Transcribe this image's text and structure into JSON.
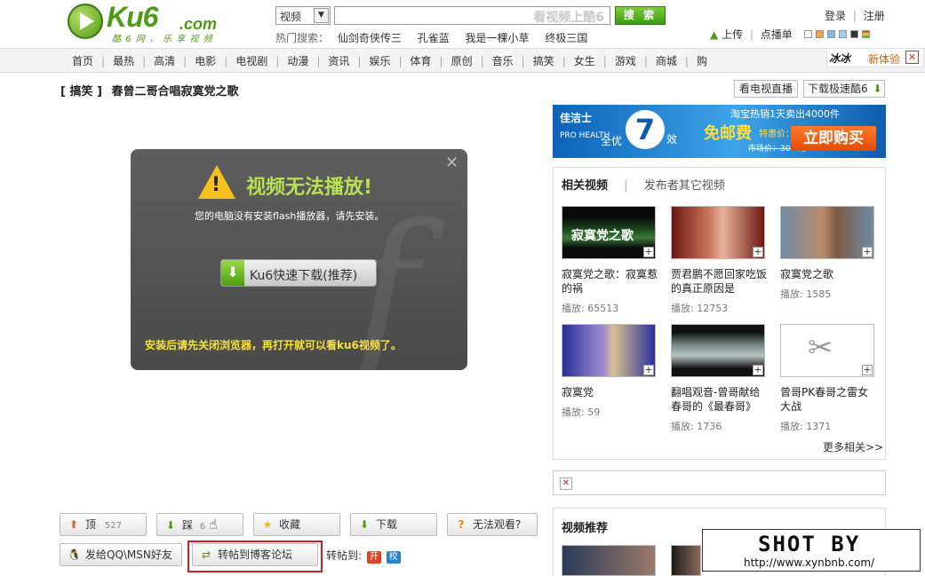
{
  "header": {
    "logo_text": "Ku6",
    "logo_domain": ".com",
    "logo_slogan": "酷 6 网 ， 乐 享 视 频",
    "search_type": "视频",
    "search_placeholder": "看视频上酷6",
    "search_button": "搜 索",
    "hot_label": "热门搜索：",
    "hot_terms": [
      "仙剑奇侠传三",
      "孔雀蓝",
      "我是一棵小草",
      "终极三国"
    ],
    "login": "登录",
    "register": "注册",
    "upload": "上传",
    "playlist": "点播单",
    "swatch_colors": [
      "#ffffff",
      "#f0a040",
      "#7fb8e8",
      "#9fd0f0",
      "#333333",
      "#5aa0d8"
    ],
    "new_experience": "新体验"
  },
  "nav": {
    "items": [
      "首页",
      "最热",
      "高清",
      "电影",
      "电视剧",
      "动漫",
      "资讯",
      "娱乐",
      "体育",
      "原创",
      "音乐",
      "搞笑",
      "女生",
      "游戏",
      "商城",
      "购"
    ]
  },
  "video": {
    "category": "[ 搞笑 ]",
    "title": "春曾二哥合唱寂寞党之歌",
    "tv_live": "看电视直播",
    "download_fast": "下载极速酷6"
  },
  "player": {
    "error_title": "视频无法播放!",
    "error_msg": "您的电脑没有安装flash播放器，请先安装。",
    "download_btn": "Ku6快速下载(推荐)",
    "note": "安装后请先关闭浏览器，再打开就可以看ku6视频了。"
  },
  "actions": {
    "up": "顶",
    "up_count": "527",
    "down": "踩",
    "down_count": "6",
    "fav": "收藏",
    "download": "下载",
    "cant_watch": "无法观看?",
    "send_qq": "发给QQ\\MSN好友",
    "repost": "转帖到博客论坛",
    "share_label": "转帖到:",
    "share_kaixin": "开",
    "share_xiaonei": "校"
  },
  "ad": {
    "brand": "佳洁士",
    "brand_sub": "PRO HEALTH",
    "all_effects": "全优",
    "seven": "7",
    "effects": "效",
    "banner_line1": "淘宝热销1天卖出4000件",
    "free_shipping": "免邮费",
    "special_price": "特惠价：20.9元",
    "market_price": "市场价：30.9元",
    "buy_now": "立即购买"
  },
  "related": {
    "tab_active": "相关视频",
    "tab_other": "发布者其它视频",
    "items": [
      {
        "title": "寂寞党之歌：寂寞惹的祸",
        "plays_label": "播放:",
        "plays": "65513"
      },
      {
        "title": "贾君鹏不愿回家吃饭的真正原因是",
        "plays_label": "播放:",
        "plays": "12753"
      },
      {
        "title": "寂寞党之歌",
        "plays_label": "播放:",
        "plays": "1585"
      },
      {
        "title": "寂寞党",
        "plays_label": "播放:",
        "plays": "59"
      },
      {
        "title": "翻唱观音-曾哥献给春哥的《最春哥》",
        "plays_label": "播放:",
        "plays": "1736"
      },
      {
        "title": "曾哥PK春哥之雷女大战",
        "plays_label": "播放:",
        "plays": "1371"
      }
    ],
    "more": "更多相关>>"
  },
  "recommend": {
    "title": "视频推荐"
  },
  "watermark": {
    "line1": "SHOT BY",
    "line2": "http://www.xynbnb.com/"
  }
}
